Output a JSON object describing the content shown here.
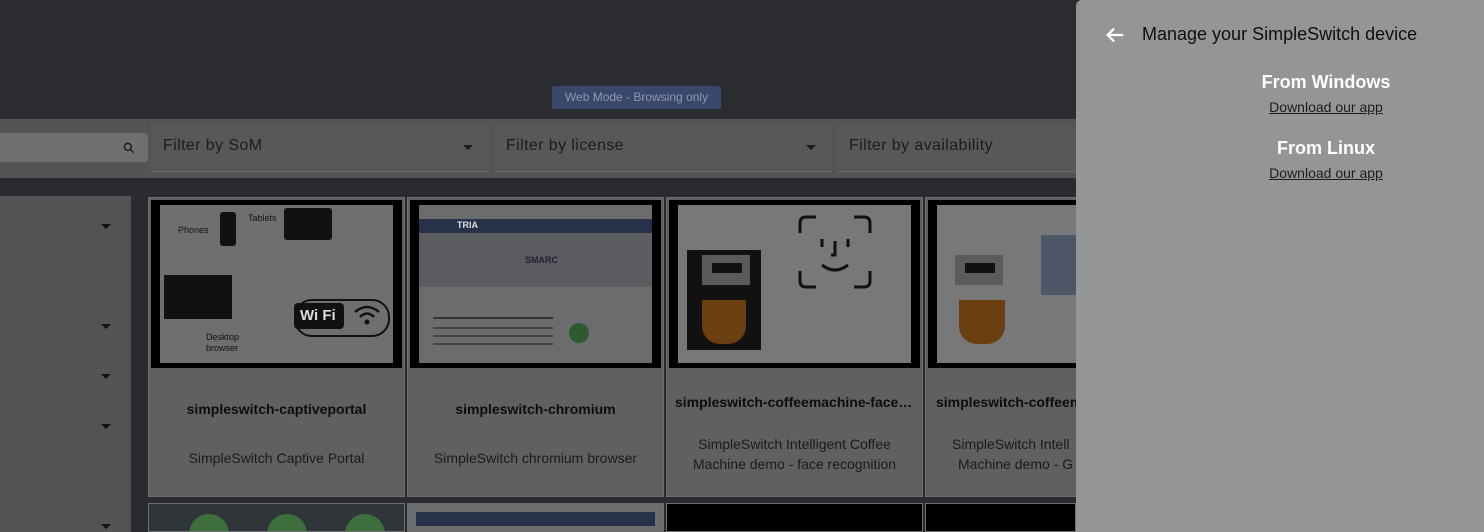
{
  "header": {
    "mode_badge": "Web Mode - Browsing only"
  },
  "filters": {
    "som": "Filter by SoM",
    "license": "Filter by license",
    "availability": "Filter by availability"
  },
  "cards": [
    {
      "title": "simpleswitch-captiveportal",
      "desc": "SimpleSwitch Captive Portal",
      "thumb": {
        "phones": "Phones",
        "tablets": "Tablets",
        "wifi": "Wi Fi",
        "desktop": "Desktop",
        "browser": "browser"
      }
    },
    {
      "title": "simpleswitch-chromium",
      "desc": "SimpleSwitch chromium browser",
      "thumb": {
        "brand": "TRIA",
        "smarc": "SMARC"
      }
    },
    {
      "title": "simpleswitch-coffeemachine-faced…",
      "desc_line1": "SimpleSwitch Intelligent Coffee",
      "desc_line2": "Machine demo - face recognition"
    },
    {
      "title": "simpleswitch-coffeem",
      "desc_line1": "SimpleSwitch Intell",
      "desc_line2": "Machine demo - G"
    }
  ],
  "panel": {
    "title": "Manage your SimpleSwitch device",
    "windows": {
      "heading": "From Windows",
      "link": "Download our app"
    },
    "linux": {
      "heading": "From Linux",
      "link": "Download our app"
    }
  },
  "colors": {
    "overlay_panel": "#949596",
    "badge": "#38476a",
    "topbar": "#2b2c30"
  },
  "icons": {
    "back": "arrow-left-icon",
    "search": "search-icon",
    "caret": "caret-down-icon"
  }
}
